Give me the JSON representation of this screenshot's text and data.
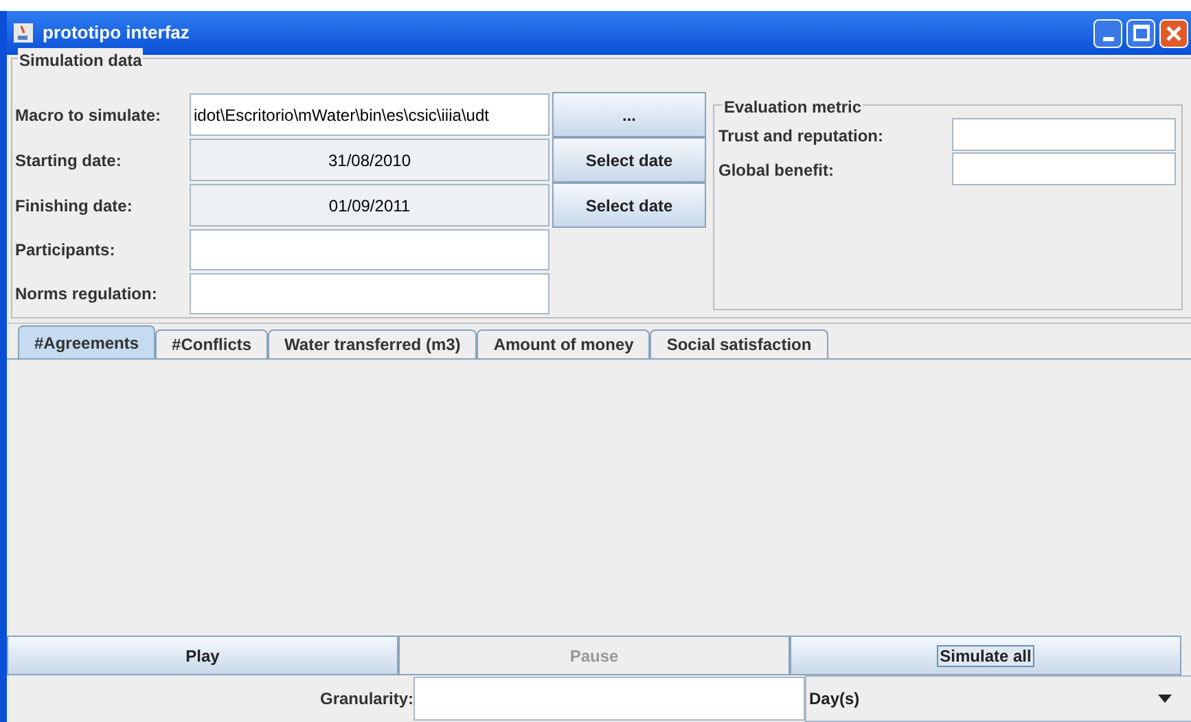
{
  "window": {
    "title": "prototipo interfaz"
  },
  "simulation_data": {
    "title": "Simulation data",
    "macro": {
      "label": "Macro to simulate:",
      "value": "idot\\Escritorio\\mWater\\bin\\es\\csic\\iiia\\udt",
      "button": "..."
    },
    "starting_date": {
      "label": "Starting date:",
      "value": "31/08/2010",
      "button": "Select date"
    },
    "finishing_date": {
      "label": "Finishing date:",
      "value": "01/09/2011",
      "button": "Select date"
    },
    "participants": {
      "label": "Participants:"
    },
    "norms_regulation": {
      "label": "Norms regulation:"
    }
  },
  "evaluation_metric": {
    "title": "Evaluation metric",
    "fields": [
      {
        "label": "Trust and reputation:"
      },
      {
        "label": "Global benefit:"
      }
    ]
  },
  "tabs": [
    {
      "label": "#Agreements",
      "selected": true
    },
    {
      "label": "#Conflicts",
      "selected": false
    },
    {
      "label": "Water transferred (m3)",
      "selected": false
    },
    {
      "label": "Amount of money",
      "selected": false
    },
    {
      "label": "Social satisfaction",
      "selected": false
    }
  ],
  "controls": [
    {
      "label": "Play",
      "disabled": false,
      "focused": false
    },
    {
      "label": "Pause",
      "disabled": true,
      "focused": false
    },
    {
      "label": "Simulate all",
      "disabled": false,
      "focused": true
    }
  ],
  "granularity": {
    "label": "Granularity:",
    "unit": "Day(s)"
  }
}
